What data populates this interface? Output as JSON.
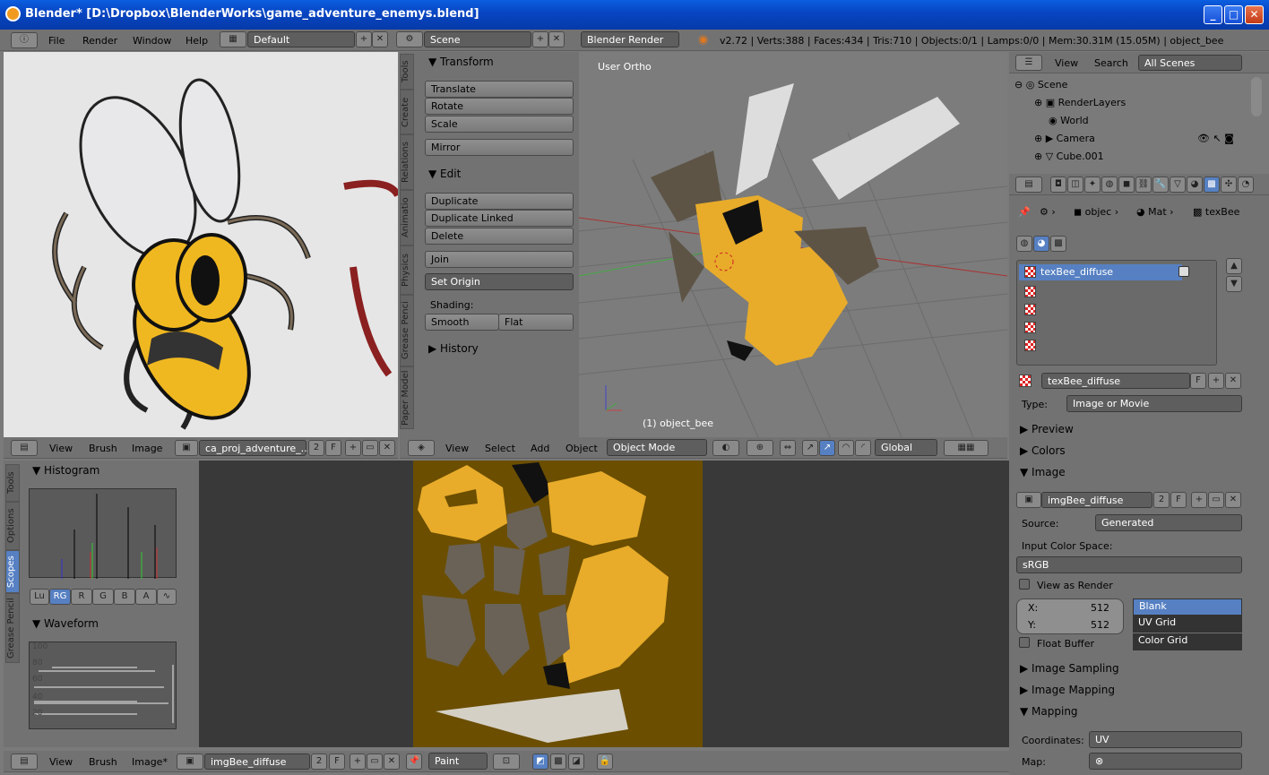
{
  "window": {
    "title": "Blender* [D:\\Dropbox\\BlenderWorks\\game_adventure_enemys.blend]"
  },
  "topbar": {
    "menus": [
      "File",
      "Render",
      "Window",
      "Help"
    ],
    "layout": "Default",
    "scene": "Scene",
    "engine": "Blender Render",
    "stats": "v2.72 | Verts:388 | Faces:434 | Tris:710 | Objects:0/1 | Lamps:0/0 | Mem:30.31M (15.05M) | object_bee"
  },
  "tools": {
    "vtabs": [
      "Tools",
      "Create",
      "Relations",
      "Animatio",
      "Physics",
      "Grease Penci",
      "Paper Model"
    ],
    "transform": "Transform",
    "translate": "Translate",
    "rotate": "Rotate",
    "scale": "Scale",
    "mirror": "Mirror",
    "edit": "Edit",
    "duplicate": "Duplicate",
    "duplicate_linked": "Duplicate Linked",
    "delete": "Delete",
    "join": "Join",
    "set_origin": "Set Origin",
    "shading": "Shading:",
    "smooth": "Smooth",
    "flat": "Flat",
    "history": "History"
  },
  "viewport": {
    "label": "User Ortho",
    "object": "(1) object_bee",
    "menus": [
      "View",
      "Select",
      "Add",
      "Object"
    ],
    "mode": "Object Mode",
    "orientation": "Global"
  },
  "imgeditor_top": {
    "menus": [
      "View",
      "Brush",
      "Image"
    ],
    "image": "ca_proj_adventure_...",
    "users": "2",
    "f": "F"
  },
  "scopes": {
    "vtabs": [
      "Tools",
      "Options",
      "Scopes",
      "Grease Pencil"
    ],
    "histogram": "Histogram",
    "channels": [
      "Lu",
      "RG",
      "R",
      "G",
      "B",
      "A"
    ],
    "waveform": "Waveform",
    "wf_ticks": [
      "100",
      "80",
      "60",
      "40",
      "20"
    ]
  },
  "imgeditor_bottom": {
    "menus": [
      "View",
      "Brush",
      "Image*"
    ],
    "image": "imgBee_diffuse",
    "users": "2",
    "f": "F",
    "paint": "Paint"
  },
  "outliner": {
    "menus": [
      "View",
      "Search"
    ],
    "filter": "All Scenes",
    "tree": [
      "Scene",
      "RenderLayers",
      "World",
      "Camera",
      "Cube.001"
    ]
  },
  "props": {
    "breadcrumb": [
      "objec",
      "Mat",
      "texBee"
    ],
    "tex_slot": "texBee_diffuse",
    "texture_name": "texBee_diffuse",
    "f": "F",
    "type_label": "Type:",
    "type": "Image or Movie",
    "preview": "Preview",
    "colors": "Colors",
    "image": "Image",
    "img_name": "imgBee_diffuse",
    "img_users": "2",
    "img_f": "F",
    "source_label": "Source:",
    "source": "Generated",
    "ics_label": "Input Color Space:",
    "ics": "sRGB",
    "view_as_render": "View as Render",
    "x_label": "X:",
    "x": "512",
    "y_label": "Y:",
    "y": "512",
    "float_buffer": "Float Buffer",
    "gen_types": [
      "Blank",
      "UV Grid",
      "Color Grid"
    ],
    "sampling": "Image Sampling",
    "mapping_img": "Image Mapping",
    "mapping": "Mapping",
    "coords_label": "Coordinates:",
    "coords": "UV",
    "map_label": "Map:"
  }
}
